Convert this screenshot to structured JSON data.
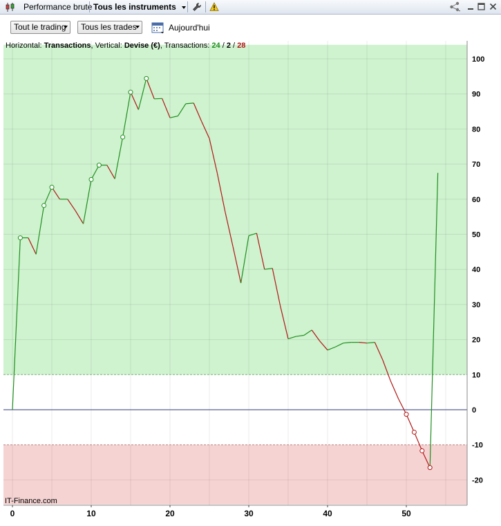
{
  "header": {
    "tab_performance": "Performance brute",
    "tab_instruments": "Tous les instruments"
  },
  "toolbar": {
    "trading_select": "Tout le trading",
    "trades_select": "Tous les trades",
    "date_label": "Aujourd'hui"
  },
  "info": {
    "horizontal_label": "Horizontal:",
    "horizontal_value": "Transactions",
    "vertical_label": "Vertical:",
    "vertical_value": "Devise (€)",
    "transactions_label": "Transactions:",
    "count_winning": "24",
    "count_neutral": "2",
    "count_losing": "28"
  },
  "footer": {
    "source": "IT-Finance.com"
  },
  "colors": {
    "up": "#1e8f1e",
    "down": "#b21616",
    "profit_zone": "#cff2cf",
    "loss_zone": "#f6d3d3",
    "zero_line": "#2d3a7a"
  },
  "chart_data": {
    "type": "line",
    "xlabel": "",
    "ylabel": "",
    "xlim": [
      -1,
      58
    ],
    "ylim": [
      -27,
      104
    ],
    "x_ticks": [
      0,
      10,
      20,
      30,
      40,
      50
    ],
    "y_ticks": [
      100,
      90,
      80,
      70,
      60,
      50,
      40,
      30,
      20,
      10,
      0,
      -10,
      -20
    ],
    "bands": [
      {
        "name": "profit",
        "from": 10,
        "to": 104
      },
      {
        "name": "loss",
        "from": -27,
        "to": -10
      }
    ],
    "x": [
      0,
      1,
      2,
      3,
      4,
      5,
      6,
      7,
      8,
      9,
      10,
      11,
      12,
      13,
      14,
      15,
      16,
      17,
      18,
      19,
      20,
      21,
      22,
      23,
      24,
      25,
      26,
      27,
      28,
      29,
      30,
      31,
      32,
      33,
      34,
      35,
      36,
      37,
      38,
      39,
      40,
      41,
      42,
      43,
      44,
      45,
      46,
      47,
      48,
      49,
      50,
      51,
      52,
      53,
      54
    ],
    "values": [
      0,
      49,
      49,
      44.3,
      58.2,
      63.4,
      60,
      60,
      56.7,
      53,
      65.6,
      69.7,
      69.7,
      65.8,
      77.7,
      90.5,
      85.5,
      94.4,
      88.6,
      88.7,
      83.2,
      83.7,
      87.2,
      87.4,
      82.2,
      77.3,
      67.4,
      56.4,
      46.4,
      36.1,
      49.6,
      50.3,
      40,
      40.3,
      29.6,
      20.2,
      20.9,
      21.2,
      22.7,
      19.6,
      17,
      17.9,
      19,
      19.2,
      19.2,
      19,
      19.2,
      14.2,
      8.2,
      3.1,
      -1.3,
      -6.4,
      -11.7,
      -16.5,
      67.5
    ],
    "markers": [
      1,
      4,
      5,
      10,
      11,
      14,
      15,
      17,
      50,
      51,
      52,
      53
    ]
  }
}
